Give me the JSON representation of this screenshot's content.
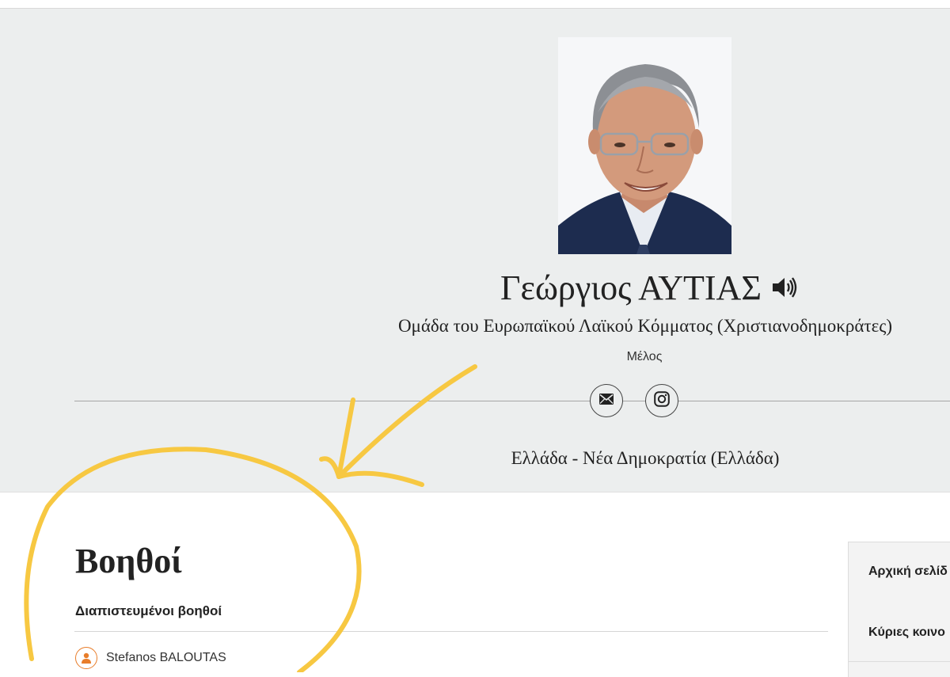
{
  "profile": {
    "name": "Γεώργιος ΑΥΤΙΑΣ",
    "political_group": "Ομάδα του Ευρωπαϊκού Λαϊκού Κόμματος (Χριστιανοδημοκράτες)",
    "role": "Μέλος",
    "country_party": "Ελλάδα - Νέα Δημοκρατία (Ελλάδα)",
    "icons": [
      "speaker-icon",
      "email-icon",
      "instagram-icon"
    ]
  },
  "assistants": {
    "title": "Βοηθοί",
    "subtitle": "Διαπιστευμένοι βοηθοί",
    "list": [
      {
        "name": "Stefanos BALOUTAS",
        "icon": "person-icon"
      }
    ]
  },
  "side_nav": {
    "items": [
      {
        "label": "Αρχική σελίδ"
      },
      {
        "label": "Κύριες κοινο"
      }
    ]
  },
  "colors": {
    "hero_background": "#eceeee",
    "accent_orange": "#e87d2a",
    "annotation_yellow": "#f7c842"
  }
}
